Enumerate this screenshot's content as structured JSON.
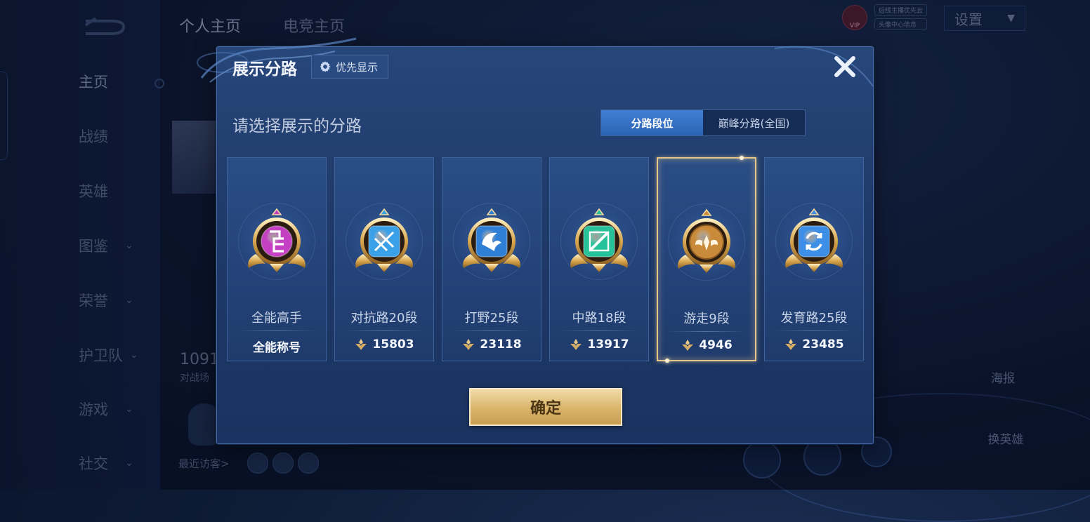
{
  "background": {
    "top_tabs": [
      "个人主页",
      "电竞主页"
    ],
    "sidebar": {
      "items": [
        {
          "label": "主页",
          "has_chevron": false,
          "active": true
        },
        {
          "label": "战绩",
          "has_chevron": false
        },
        {
          "label": "英雄",
          "has_chevron": false
        },
        {
          "label": "图鉴",
          "has_chevron": true
        },
        {
          "label": "荣誉",
          "has_chevron": true
        },
        {
          "label": "护卫队",
          "has_chevron": true
        },
        {
          "label": "游戏",
          "has_chevron": true
        },
        {
          "label": "社交",
          "has_chevron": true
        }
      ]
    },
    "settings_label": "设置",
    "vip_label": "VIP",
    "small_buttons": [
      "后线主播优先云",
      "头像中心信息"
    ],
    "match_count": "1091",
    "match_count_label": "对战场",
    "recent_visitors": "最近访客>",
    "right_poster": "海报",
    "right_change_hero": "换英雄"
  },
  "modal": {
    "title": "展示分路",
    "priority_label": "优先显示",
    "subtitle": "请选择展示的分路",
    "segments": [
      {
        "label": "分路段位",
        "active": true
      },
      {
        "label": "巅峰分路(全国)",
        "active": false
      }
    ],
    "cards": [
      {
        "name": "全能高手",
        "value": "全能称号",
        "show_icon": false,
        "badge": "all-round",
        "color": "#c43fc2",
        "selected": false
      },
      {
        "name": "对抗路20段",
        "value": "15803",
        "show_icon": true,
        "badge": "clash-lane",
        "color": "#3aa0e8",
        "selected": false
      },
      {
        "name": "打野25段",
        "value": "23118",
        "show_icon": true,
        "badge": "jungle",
        "color": "#2f7fd6",
        "selected": false
      },
      {
        "name": "中路18段",
        "value": "13917",
        "show_icon": true,
        "badge": "mid-lane",
        "color": "#27c29a",
        "selected": false
      },
      {
        "name": "游走9段",
        "value": "4946",
        "show_icon": true,
        "badge": "roam",
        "color": "#c98a3a",
        "selected": true
      },
      {
        "name": "发育路25段",
        "value": "23485",
        "show_icon": true,
        "badge": "farm-lane",
        "color": "#3d8ee6",
        "selected": false
      }
    ],
    "confirm_label": "确定"
  }
}
